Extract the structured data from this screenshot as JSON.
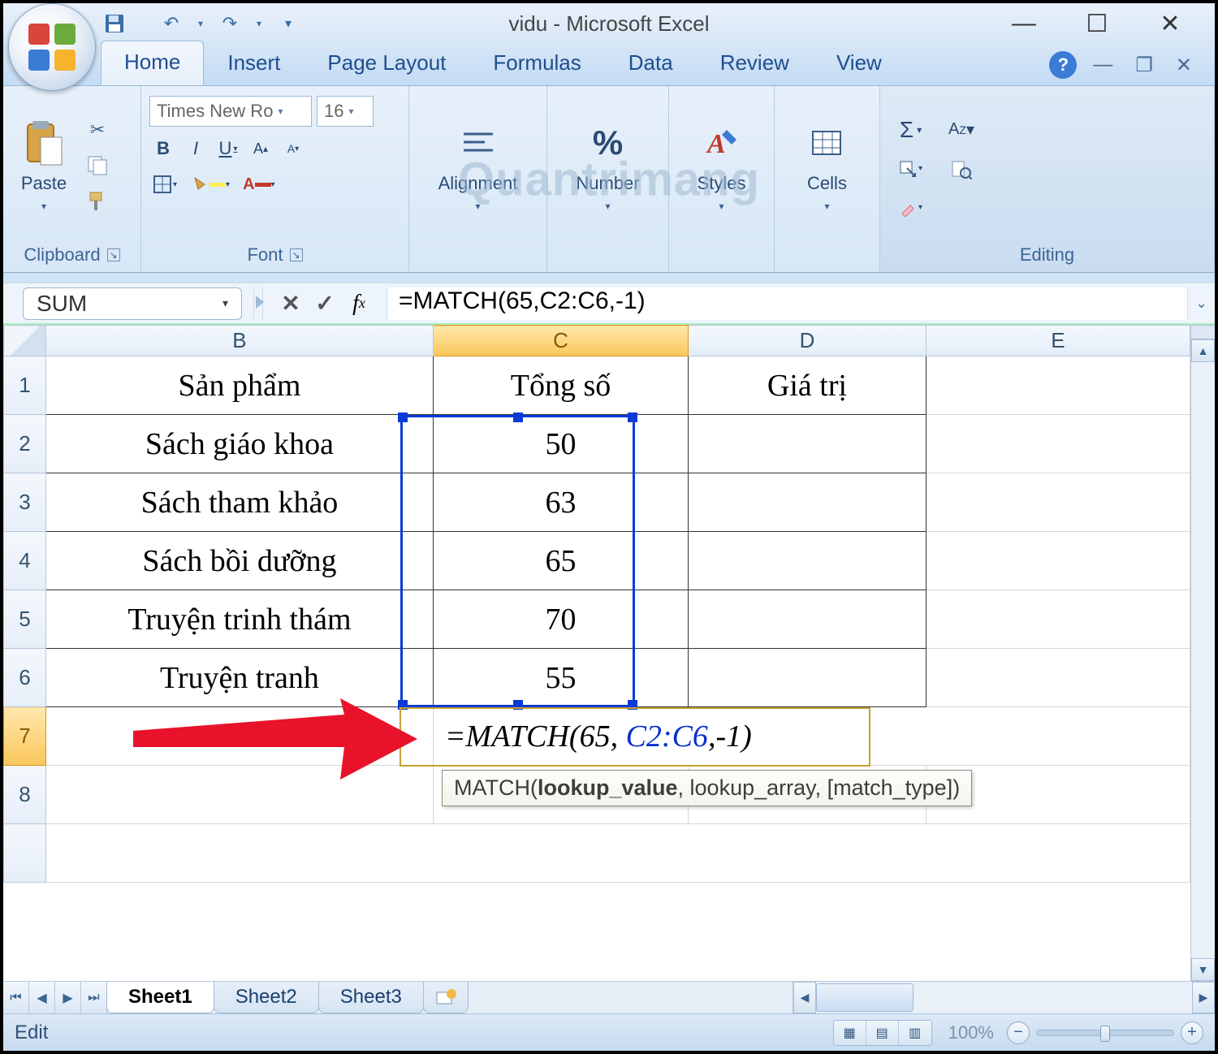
{
  "title": "vidu - Microsoft Excel",
  "qat": {
    "save": "save-icon",
    "undo": "undo-icon",
    "redo": "redo-icon",
    "custom": "▾"
  },
  "tabs": [
    "Home",
    "Insert",
    "Page Layout",
    "Formulas",
    "Data",
    "Review",
    "View"
  ],
  "active_tab": "Home",
  "ribbon": {
    "clipboard": {
      "label": "Clipboard",
      "paste": "Paste"
    },
    "font": {
      "label": "Font",
      "font_name": "Times New Ro",
      "font_size": "16",
      "bold": "B",
      "italic": "I",
      "underline": "U"
    },
    "alignment": {
      "label": "Alignment"
    },
    "number": {
      "label": "Number",
      "icon": "%"
    },
    "styles": {
      "label": "Styles"
    },
    "cells": {
      "label": "Cells"
    },
    "editing": {
      "label": "Editing",
      "sigma": "Σ"
    }
  },
  "watermark": "Quantrimang",
  "namebox": "SUM",
  "formula_bar": "=MATCH(65,C2:C6,-1)",
  "columns": [
    "B",
    "C",
    "D",
    "E"
  ],
  "active_col": "C",
  "active_row": "7",
  "rows": [
    {
      "n": "1",
      "B": "Sản phẩm",
      "C": "Tổng số",
      "D": "Giá trị",
      "E": ""
    },
    {
      "n": "2",
      "B": "Sách giáo khoa",
      "C": "50",
      "D": "",
      "E": ""
    },
    {
      "n": "3",
      "B": "Sách tham khảo",
      "C": "63",
      "D": "",
      "E": ""
    },
    {
      "n": "4",
      "B": "Sách bồi dưỡng",
      "C": "65",
      "D": "",
      "E": ""
    },
    {
      "n": "5",
      "B": "Truyện trinh thám",
      "C": "70",
      "D": "",
      "E": ""
    },
    {
      "n": "6",
      "B": "Truyện tranh",
      "C": "55",
      "D": "",
      "E": ""
    }
  ],
  "edit_row_n": "7",
  "row8_n": "8",
  "edit_cell": {
    "prefix": "=MATCH(65, ",
    "range": "C2:C6",
    "suffix": ",-1)"
  },
  "tooltip": {
    "fn": "MATCH(",
    "bold": "lookup_value",
    "rest": ", lookup_array, [match_type])"
  },
  "sheet_tabs": [
    "Sheet1",
    "Sheet2",
    "Sheet3"
  ],
  "active_sheet": "Sheet1",
  "status": {
    "mode": "Edit",
    "zoom": "100%"
  }
}
